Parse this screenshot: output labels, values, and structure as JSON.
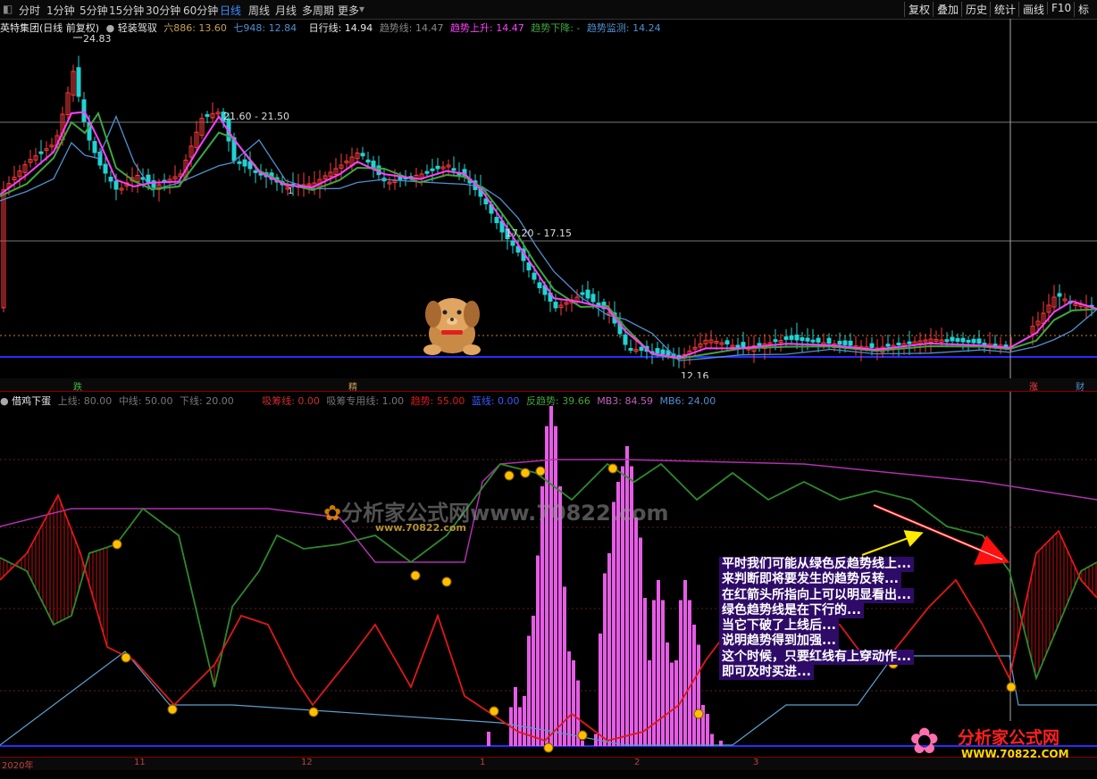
{
  "toolbar": {
    "items": [
      "分时",
      "1分钟",
      "5分钟",
      "15分钟",
      "30分钟",
      "60分钟",
      "日线",
      "周线",
      "月线",
      "多周期",
      "更多"
    ],
    "active": "日线",
    "right": [
      "复权",
      "叠加",
      "历史",
      "统计",
      "画线",
      "F10",
      "标"
    ]
  },
  "main_legend": {
    "stock": "英特集团(日线 前复权)",
    "indicator": "轻装驾驭",
    "l6": "六886: 13.60",
    "l7": "七948: 12.84",
    "daily": "日行线: 14.94",
    "trend": "趋势线: 14.47",
    "up": "趋势上升: 14.47",
    "down": "趋势下降: -",
    "monitor": "趋势监测: 14.24"
  },
  "price_labels": {
    "high": "24.83",
    "range1": "21.60 - 21.50",
    "range2": "17.20 - 17.15",
    "low": "12.16",
    "tick": "1"
  },
  "signals": [
    "跌",
    "精",
    "涨",
    "财"
  ],
  "sub_legend": {
    "name": "借鸡下蛋",
    "upper": "上线: 80.00",
    "middle": "中线: 50.00",
    "lower": "下线: 20.00",
    "chip": "吸筹线: 0.00",
    "chip2": "吸筹专用线: 1.00",
    "trend": "趋势: 55.00",
    "blue": "蓝线: 0.00",
    "anti": "反趋势: 39.66",
    "mb3": "MB3: 84.59",
    "mb6": "MB6: 24.00"
  },
  "dates": [
    "2020年",
    "11",
    "12",
    "1",
    "2",
    "3"
  ],
  "annotation": [
    "平时我们可能从绿色反趋势线上...",
    "来判断即将要发生的趋势反转...",
    "在红箭头所指向上可以明显看出...",
    "绿色趋势线是在下行的...",
    "当它下破了上线后...",
    "说明趋势得到加强...",
    "这个时候，只要红线有上穿动作...",
    "即可及时买进..."
  ],
  "watermark": {
    "site": "分析家公式网",
    "url": "WWW.70822.COM",
    "center_text": "分析家公式网www.70822.com",
    "center_url": "www.70822.com"
  },
  "colors": {
    "bull": "#ff3b3b",
    "bear": "#22d3d3",
    "ma_pink": "#ff40ff",
    "ma_green": "#3fa63f",
    "ma_blue": "#4f8fd0",
    "red_line": "#e01818",
    "green_line": "#2d8a2d",
    "purple_line": "#b030b0",
    "bar": "#ff66ff"
  }
}
